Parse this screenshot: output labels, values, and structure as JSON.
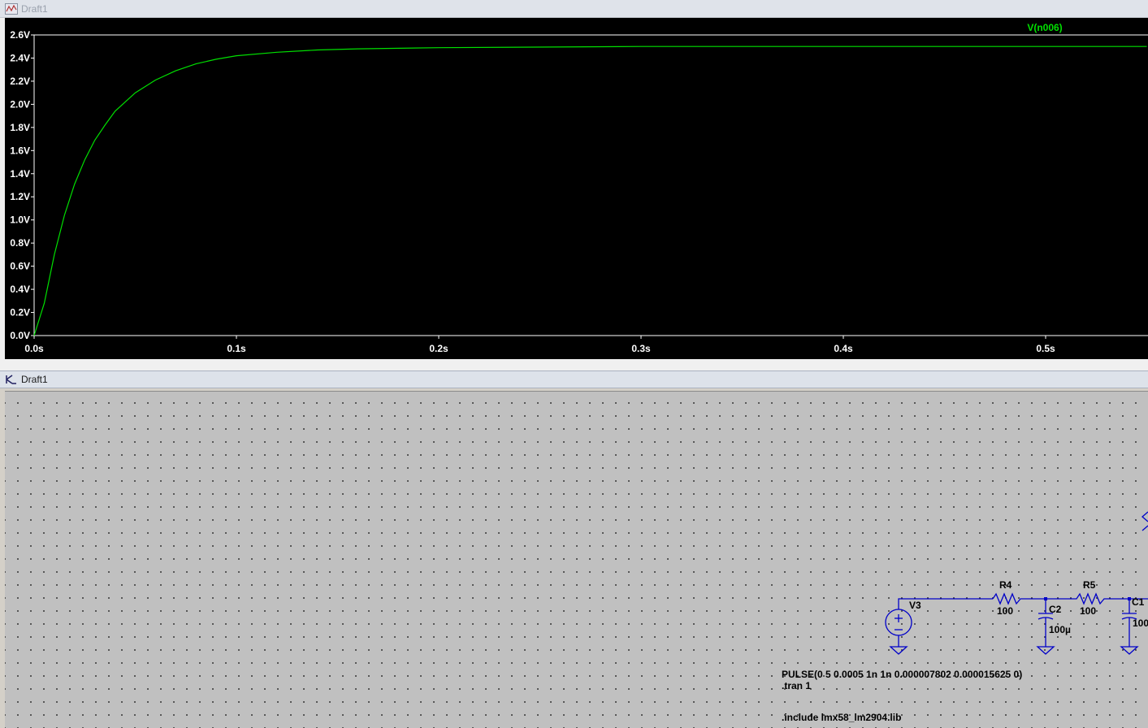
{
  "waveform_window": {
    "title": "Draft1",
    "trace_label": "V(n006)",
    "trace_color": "#00e000",
    "background": "#000000"
  },
  "schematic_window": {
    "title": "Draft1",
    "components": {
      "v3": {
        "name": "V3"
      },
      "r4": {
        "name": "R4",
        "value": "100"
      },
      "c2": {
        "name": "C2",
        "value": "100µ"
      },
      "r5": {
        "name": "R5",
        "value": "100"
      },
      "c1": {
        "name": "C1",
        "value": "100"
      }
    },
    "directives": {
      "pulse": "PULSE(0 5 0.0005 1n 1n 0.000007802 0.000015625 0)",
      "tran": ".tran 1",
      "include": ".include lmx58_lm2904.lib"
    },
    "wire_color": "#0000c8"
  },
  "chart_data": {
    "type": "line",
    "title": "",
    "xlabel": "",
    "ylabel": "",
    "xlim": [
      0,
      0.55
    ],
    "ylim": [
      0,
      2.6
    ],
    "x_ticks": [
      "0.0s",
      "0.1s",
      "0.2s",
      "0.3s",
      "0.4s",
      "0.5s"
    ],
    "y_ticks": [
      "0.0V",
      "0.2V",
      "0.4V",
      "0.6V",
      "0.8V",
      "1.0V",
      "1.2V",
      "1.4V",
      "1.6V",
      "1.8V",
      "2.0V",
      "2.2V",
      "2.4V",
      "2.6V"
    ],
    "series": [
      {
        "name": "V(n006)",
        "x": [
          0,
          0.005,
          0.01,
          0.015,
          0.02,
          0.025,
          0.03,
          0.035,
          0.04,
          0.05,
          0.06,
          0.07,
          0.08,
          0.09,
          0.1,
          0.12,
          0.14,
          0.16,
          0.2,
          0.3,
          0.4,
          0.5,
          0.55
        ],
        "y": [
          0,
          0.28,
          0.7,
          1.04,
          1.31,
          1.52,
          1.69,
          1.82,
          1.94,
          2.1,
          2.21,
          2.29,
          2.35,
          2.39,
          2.42,
          2.45,
          2.47,
          2.48,
          2.49,
          2.5,
          2.5,
          2.5,
          2.5
        ]
      }
    ]
  }
}
